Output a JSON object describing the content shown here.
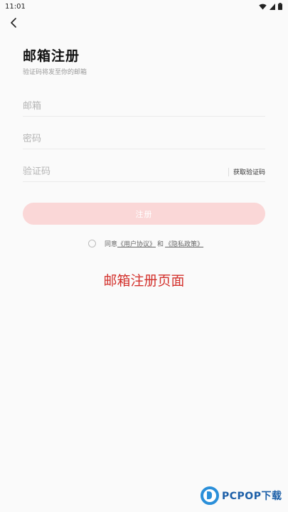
{
  "status_bar": {
    "time": "11:01",
    "icons": [
      "wifi-icon",
      "cellular-icon",
      "battery-icon"
    ]
  },
  "header": {
    "back_icon": "chevron-left-icon",
    "title": "邮箱注册",
    "subtitle": "验证码将发至你的邮箱"
  },
  "form": {
    "email": {
      "placeholder": "邮箱",
      "value": ""
    },
    "password": {
      "placeholder": "密码",
      "value": ""
    },
    "code": {
      "placeholder": "验证码",
      "value": "",
      "get_code_label": "获取验证码"
    },
    "submit_label": "注册",
    "agreement": {
      "prefix": "同意",
      "user_agreement": "《用户协议》",
      "conjunction": "和",
      "privacy_policy": "《隐私政策》",
      "checked": false
    }
  },
  "caption": "邮箱注册页面",
  "watermark": {
    "brand": "PCPOP下载"
  },
  "colors": {
    "accent_disabled": "#fad7d7",
    "caption": "#d3312c",
    "background": "#fafafa"
  }
}
